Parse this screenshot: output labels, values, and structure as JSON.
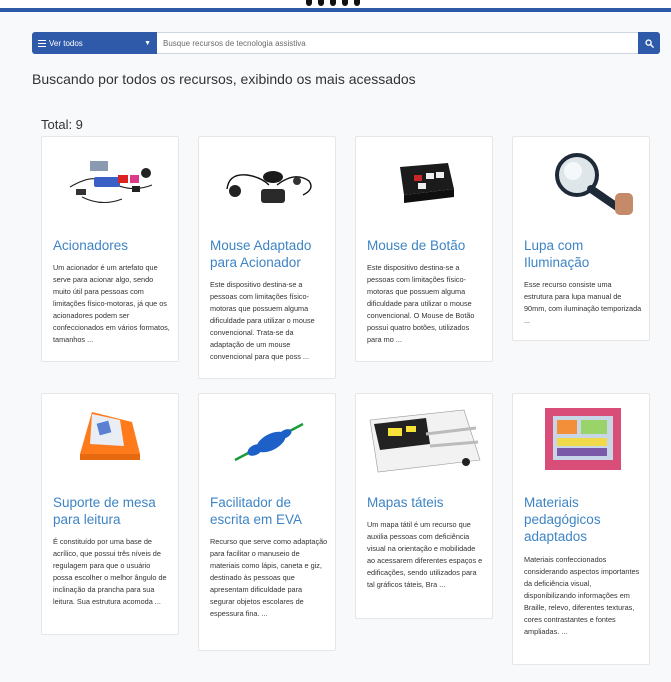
{
  "search": {
    "filter_label": "Ver todos",
    "placeholder": "Busque recursos de tecnologia assistiva"
  },
  "heading": "Buscando por todos os recursos, exibindo os mais acessados",
  "total": "Total: 9",
  "colors": {
    "primary": "#2e5aa9",
    "link": "#3e84c4",
    "header_line": "#2f5aa8"
  },
  "cards": [
    {
      "title": "Acionadores",
      "desc": "Um acionador é um artefato que serve para acionar algo, sendo muito útil para pessoas com limitações físico-motoras, já que os acionadores podem ser confeccionados em vários formatos, tamanhos ...",
      "image": "switch-devices"
    },
    {
      "title": "Mouse Adaptado para Acionador",
      "desc": "Este dispositivo destina-se a pessoas com limitações físico-motoras que possuem alguma dificuldade para utilizar o mouse convencional. Trata-se da adaptação de um mouse convencional para que poss ...",
      "image": "adapted-mouse"
    },
    {
      "title": "Mouse de Botão",
      "desc": "Este dispositivo destina-se a pessoas com limitações físico-motoras que possuem alguma dificuldade para utilizar o mouse convencional. O Mouse de Botão possui quatro botões, utilizados para mo ...",
      "image": "button-mouse"
    },
    {
      "title": "Lupa com Iluminação",
      "desc": "Esse recurso consiste uma estrutura para lupa manual de 90mm, com iluminação temporizada ...",
      "image": "magnifier"
    },
    {
      "title": "Suporte de mesa para leitura",
      "desc": "É constituído por uma base de acrílico, que possui três níveis de regulagem para que o usuário possa escolher o melhor ângulo de inclinação da prancha para sua leitura. Sua estrutura acomoda ...",
      "image": "reading-stand"
    },
    {
      "title": "Facilitador de escrita em EVA",
      "desc": "Recurso que serve como adaptação para facilitar o manuseio de materiais como lápis, caneta e giz, destinado às pessoas que apresentam dificuldade para segurar objetos escolares de espessura fina. ...",
      "image": "pencil-grip"
    },
    {
      "title": "Mapas táteis",
      "desc": "Um mapa tátil é um recurso que auxilia pessoas com deficiência visual na orientação e mobilidade ao acessarem diferentes espaços e edificações, sendo utilizados para tal gráficos táteis, Bra ...",
      "image": "tactile-map"
    },
    {
      "title": "Materiais pedagógicos adaptados",
      "desc": "Materiais confeccionados considerando aspectos importantes da deficiência visual, disponibilizando informações em Braille, relevo, diferentes texturas, cores contrastantes e fontes ampliadas. ...",
      "image": "tactile-board"
    }
  ]
}
